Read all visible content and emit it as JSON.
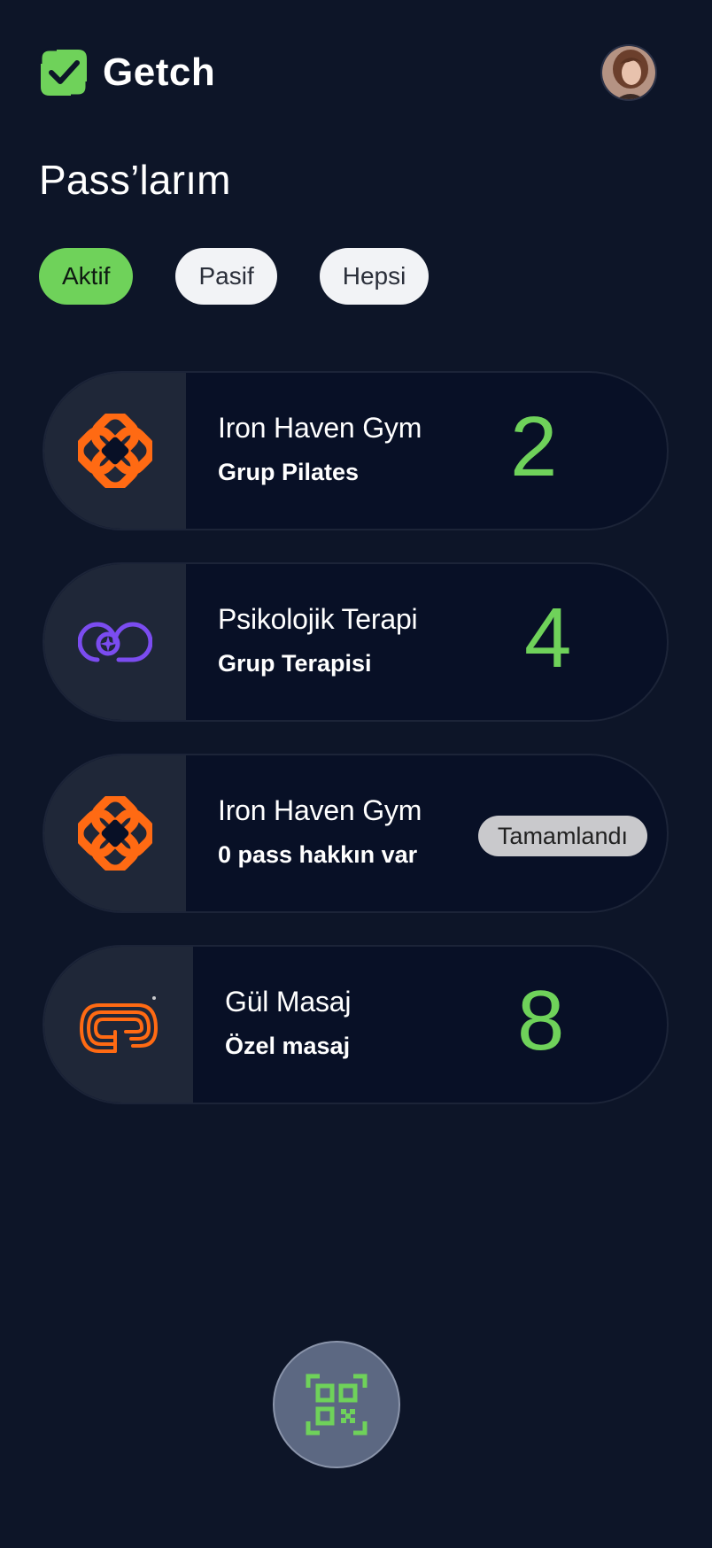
{
  "app": {
    "name": "Getch"
  },
  "page": {
    "title": "Pass’larım"
  },
  "filters": [
    {
      "label": "Aktif",
      "active": true
    },
    {
      "label": "Pasif",
      "active": false
    },
    {
      "label": "Hepsi",
      "active": false
    }
  ],
  "passes": [
    {
      "provider": "Iron Haven Gym",
      "service": "Grup Pilates",
      "count": "2",
      "icon": "orange-flower-logo-icon"
    },
    {
      "provider": "Psikolojik Terapi",
      "service": "Grup Terapisi",
      "count": "4",
      "icon": "purple-spiral-logo-icon"
    },
    {
      "provider": "Iron Haven Gym",
      "service": "0 pass hakkın var",
      "status": "Tamamlandı",
      "icon": "orange-flower-logo-icon"
    },
    {
      "provider": "Gül Masaj",
      "service": "Özel masaj",
      "count": "8",
      "icon": "orange-loop-logo-icon"
    }
  ],
  "colors": {
    "background": "#0d1528",
    "accent_green": "#6fd25a",
    "brand_orange": "#ff6a13",
    "therapy_purple": "#7b4cf0"
  },
  "actions": {
    "scan": {
      "icon": "qr-scan-icon"
    }
  }
}
